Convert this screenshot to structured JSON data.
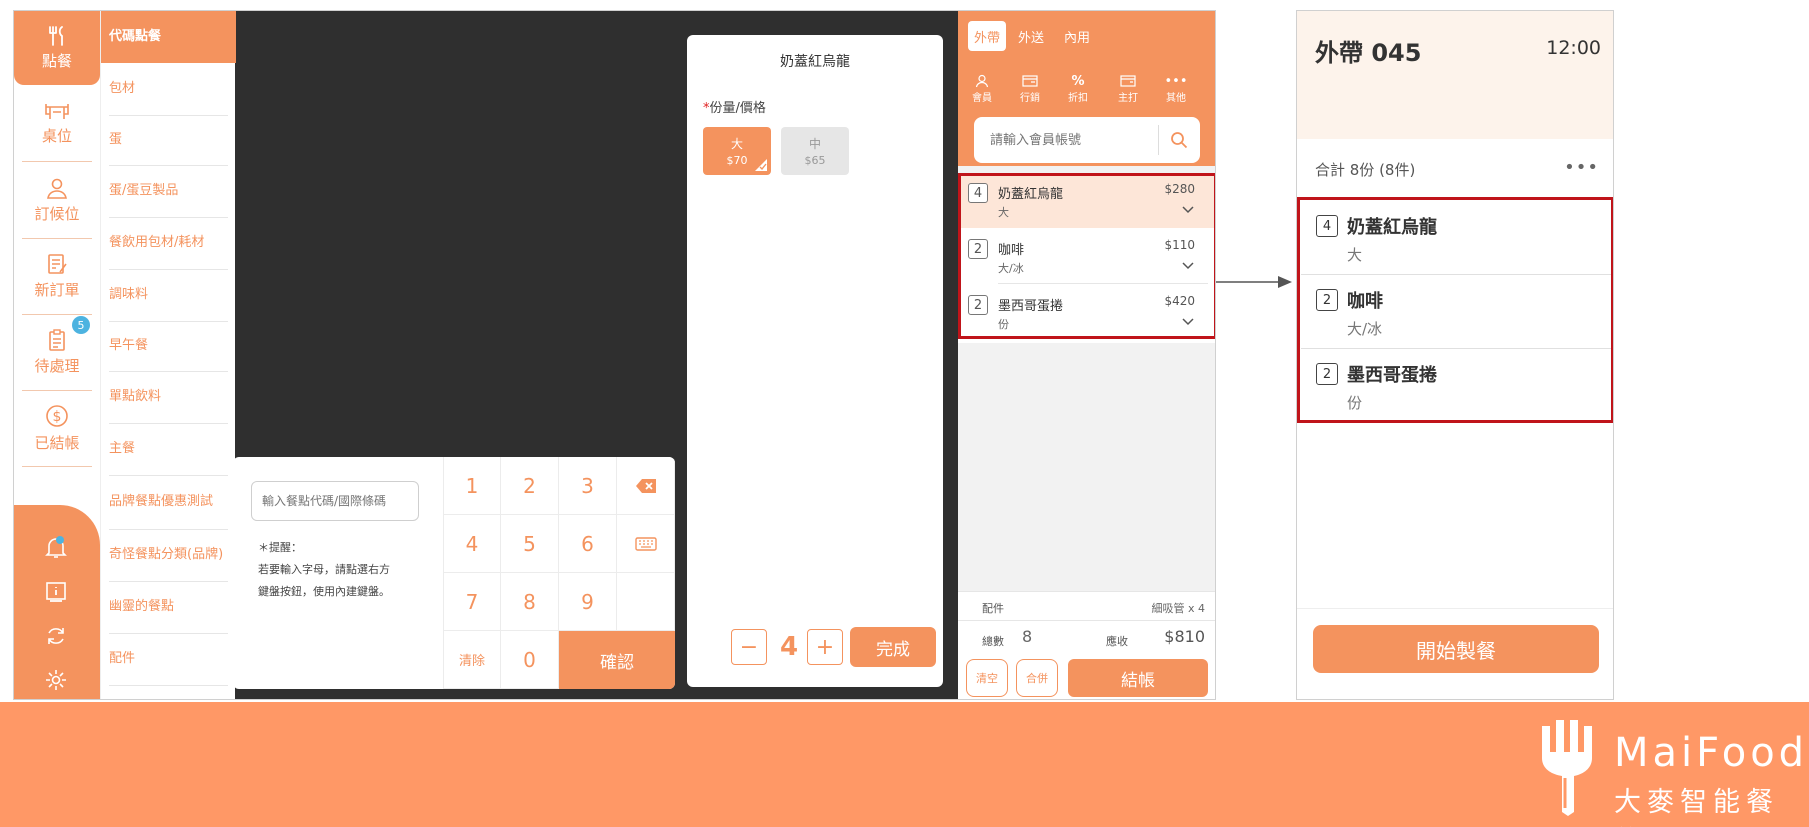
{
  "nav": {
    "items": [
      {
        "label": "點餐",
        "icon": "utensils-icon"
      },
      {
        "label": "桌位",
        "icon": "table-icon"
      },
      {
        "label": "訂候位",
        "icon": "person-icon"
      },
      {
        "label": "新訂單",
        "icon": "new-order-icon"
      },
      {
        "label": "待處理",
        "icon": "clipboard-icon"
      },
      {
        "label": "已結帳",
        "icon": "dollar-icon"
      }
    ],
    "pending_badge": "5",
    "bottom_icons": [
      "bell-icon",
      "info-icon",
      "refresh-icon",
      "gear-icon"
    ]
  },
  "categories": [
    "代碼點餐",
    "包材",
    "蛋",
    "蛋/蛋豆製品",
    "餐飲用包材/耗材",
    "調味料",
    "早午餐",
    "單點飲料",
    "主餐",
    "品牌餐點優惠測試",
    "奇怪餐點分類(品牌)",
    "幽靈的餐點",
    "配件"
  ],
  "codepad": {
    "placeholder": "輸入餐點代碼/國際條碼",
    "hint_title": "＊提醒：",
    "hint_line1": "若要輸入字母，請點選右方",
    "hint_line2": "鍵盤按鈕，使用內建鍵盤。",
    "keys": [
      "1",
      "2",
      "3",
      "4",
      "5",
      "6",
      "7",
      "8",
      "9",
      "0"
    ],
    "clear_label": "清除",
    "confirm_label": "確認"
  },
  "detail": {
    "title": "奶蓋紅烏龍",
    "portion_label": "份量/價格",
    "required_mark": "*",
    "options": [
      {
        "name": "大",
        "price": "$70",
        "selected": true
      },
      {
        "name": "中",
        "price": "$65",
        "selected": false
      }
    ],
    "quantity": "4",
    "minus": "−",
    "plus": "+",
    "done_label": "完成"
  },
  "order": {
    "tabs": [
      "外帶",
      "外送",
      "內用"
    ],
    "active_tab": "外帶",
    "tools": [
      {
        "label": "會員",
        "icon": "member-icon"
      },
      {
        "label": "行銷",
        "icon": "marketing-icon"
      },
      {
        "label": "折扣",
        "icon": "percent-icon"
      },
      {
        "label": "主打",
        "icon": "wallet-icon"
      },
      {
        "label": "其他",
        "icon": "more-icon"
      }
    ],
    "member_placeholder": "請輸入會員帳號",
    "items": [
      {
        "qty": "4",
        "name": "奶蓋紅烏龍",
        "spec": "大",
        "price": "$280"
      },
      {
        "qty": "2",
        "name": "咖啡",
        "spec": "大/冰",
        "price": "$110"
      },
      {
        "qty": "2",
        "name": "墨西哥蛋捲",
        "spec": "份",
        "price": "$420"
      }
    ],
    "accessory_label": "配件",
    "accessory_value": "細吸管 x 4",
    "total_count_label": "總數",
    "total_count": "8",
    "due_label": "應收",
    "due_amount": "$810",
    "clear_label": "清空",
    "merge_label": "合併",
    "checkout_label": "結帳"
  },
  "ticket": {
    "title": "外帶 045",
    "time": "12:00",
    "summary": "合計 8份 (8件)",
    "more": "•••",
    "items": [
      {
        "qty": "4",
        "name": "奶蓋紅烏龍",
        "spec": "大"
      },
      {
        "qty": "2",
        "name": "咖啡",
        "spec": "大/冰"
      },
      {
        "qty": "2",
        "name": "墨西哥蛋捲",
        "spec": "份"
      }
    ],
    "start_label": "開始製餐"
  },
  "brand": {
    "name_en": "MaiFood",
    "name_zh": "大麥智能餐飲"
  },
  "colors": {
    "accent": "#f4935e",
    "brand_bar": "#ff9866",
    "highlight_box": "#c0141a",
    "dark_bg": "#2f2f2f"
  }
}
